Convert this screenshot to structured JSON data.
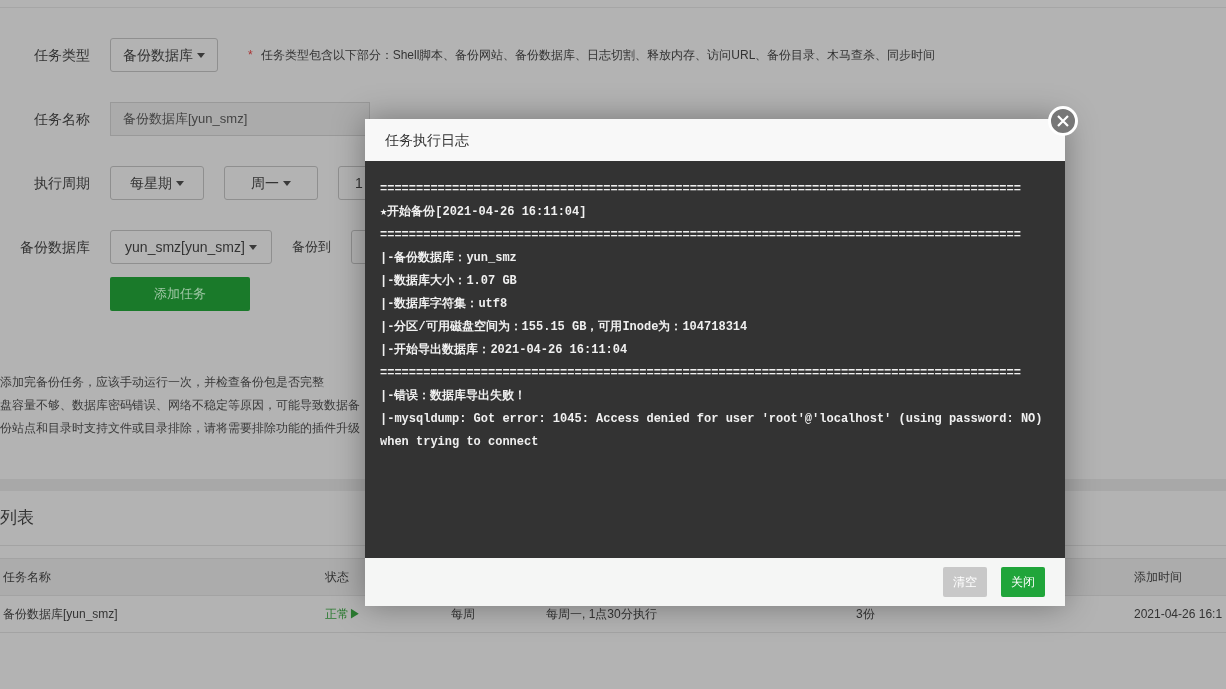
{
  "form": {
    "rows": [
      {
        "label": "任务类型",
        "kind": "type",
        "select": "备份数据库",
        "hint_mark": "*",
        "hint": "任务类型包含以下部分：Shell脚本、备份网站、备份数据库、日志切割、释放内存、访问URL、备份目录、木马查杀、同步时间"
      },
      {
        "label": "任务名称",
        "kind": "input",
        "value": "备份数据库[yun_smz]"
      },
      {
        "label": "执行周期",
        "kind": "cycle",
        "selects": [
          "每星期",
          "周一"
        ],
        "partial": "1"
      },
      {
        "label": "备份数据库",
        "kind": "backup",
        "select": "yun_smz[yun_smz]",
        "backup_to": "备份到"
      }
    ],
    "submit": "添加任务"
  },
  "notes": [
    "添加完备份任务，应该手动运行一次，并检查备份包是否完整",
    "盘容量不够、数据库密码错误、网络不稳定等原因，可能导致数据备",
    "份站点和目录时支持文件或目录排除，请将需要排除功能的插件升级"
  ],
  "list": {
    "title": "列表",
    "columns": [
      "任务名称",
      "状态",
      "添加时间"
    ],
    "row": {
      "name": "备份数据库[yun_smz]",
      "status": "正常▶",
      "cycle": "每周",
      "schedule": "每周一, 1点30分执行",
      "keep": "3份",
      "added": "2021-04-26 16:1"
    }
  },
  "dialog": {
    "title": "任务执行日志",
    "log_lines": [
      "=========================================================================================",
      "★开始备份[2021-04-26 16:11:04]",
      "=========================================================================================",
      "|-备份数据库：yun_smz",
      "|-数据库大小：1.07 GB",
      "|-数据库字符集：utf8",
      "|-分区/可用磁盘空间为：155.15 GB，可用Inode为：104718314",
      "|-开始导出数据库：2021-04-26 16:11:04",
      "=========================================================================================",
      "|-错误：数据库导出失败！",
      "|-mysqldump: Got error: 1045: Access denied for user 'root'@'localhost' (using password: NO) when trying to connect"
    ],
    "buttons": [
      {
        "label": "清空",
        "kind": "clear"
      },
      {
        "label": "关闭",
        "kind": "close"
      }
    ]
  }
}
